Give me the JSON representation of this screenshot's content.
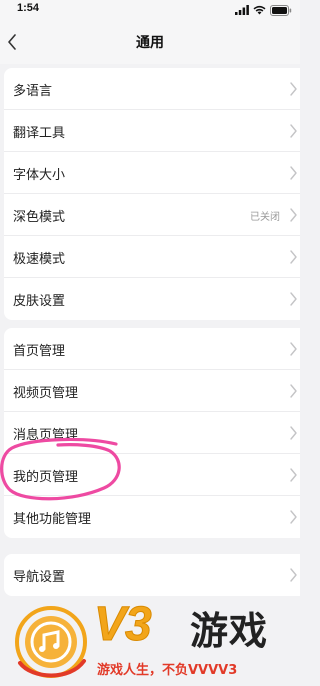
{
  "status_bar": {
    "time": "1:54"
  },
  "header": {
    "title": "通用"
  },
  "groups": [
    {
      "items": [
        {
          "label": "多语言",
          "value": ""
        },
        {
          "label": "翻译工具",
          "value": ""
        },
        {
          "label": "字体大小",
          "value": ""
        },
        {
          "label": "深色模式",
          "value": "已关闭"
        },
        {
          "label": "极速模式",
          "value": ""
        },
        {
          "label": "皮肤设置",
          "value": ""
        }
      ]
    },
    {
      "items": [
        {
          "label": "首页管理",
          "value": ""
        },
        {
          "label": "视频页管理",
          "value": ""
        },
        {
          "label": "消息页管理",
          "value": ""
        },
        {
          "label": "我的页管理",
          "value": ""
        },
        {
          "label": "其他功能管理",
          "value": ""
        }
      ]
    },
    {
      "items": [
        {
          "label": "导航设置",
          "value": ""
        }
      ]
    }
  ],
  "annotation": {
    "highlight_color": "#ee4aa2"
  },
  "watermark": {
    "brand": "V3",
    "brand_cn": "游戏",
    "slogan": "游戏人生，不负VVVV3",
    "colors": {
      "orange": "#f2a51a",
      "red": "#e23a28"
    }
  }
}
